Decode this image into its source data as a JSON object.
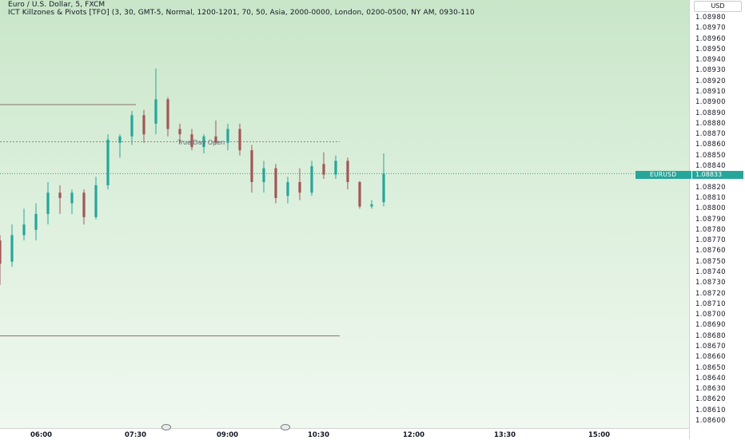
{
  "legend": {
    "line1": "Euro / U.S. Dollar, 5, FXCM",
    "line2": "ICT Killzones & Pivots [TFO] (3, 30, GMT-5, Normal, 1200-1201, 70, 50, Asia, 2000-0000, London, 0200-0500, NY AM, 0930-110"
  },
  "currency": "USD",
  "price_axis": {
    "labels": [
      "1.08980",
      "1.08970",
      "1.08960",
      "1.08950",
      "1.08940",
      "1.08930",
      "1.08920",
      "1.08910",
      "1.08900",
      "1.08890",
      "1.08880",
      "1.08870",
      "1.08860",
      "1.08850",
      "1.08840",
      "1.08820",
      "1.08810",
      "1.08800",
      "1.08790",
      "1.08780",
      "1.08770",
      "1.08760",
      "1.08750",
      "1.08740",
      "1.08730",
      "1.08720",
      "1.08710",
      "1.08700",
      "1.08690",
      "1.08680",
      "1.08670",
      "1.08660",
      "1.08650",
      "1.08640",
      "1.08630",
      "1.08620",
      "1.08610",
      "1.08600"
    ]
  },
  "time_axis": {
    "labels": [
      "06:00",
      "07:30",
      "09:00",
      "10:30",
      "12:00",
      "13:30",
      "15:00"
    ]
  },
  "last_price": {
    "symbol": "EURUSD",
    "value": "1.08833"
  },
  "annotation": {
    "true_day_open": "True Day Open"
  },
  "colors": {
    "up": "#26a69a",
    "down": "#a15757",
    "background_top": "#c9e6c9",
    "background_bottom": "#f0f8f0"
  },
  "chart_data": {
    "type": "candlestick",
    "symbol": "EURUSD",
    "timeframe": "5",
    "ylim": [
      1.08595,
      1.08985
    ],
    "levels": [
      {
        "price": 1.08898,
        "x_start": "05:35",
        "x_end": "06:35"
      },
      {
        "price": 1.08863,
        "x_start": "05:35",
        "x_end": "08:00",
        "label": "True Day Open",
        "dashed": true
      },
      {
        "price": 1.08833,
        "x_start": "05:35",
        "x_end": "16:55",
        "dotted": true
      },
      {
        "price": 1.0868,
        "x_start": "05:35",
        "x_end": "08:00"
      }
    ],
    "candles": [
      {
        "t": "05:35",
        "o": 1.0876,
        "h": 1.0878,
        "l": 1.08745,
        "c": 1.0875
      },
      {
        "t": "05:40",
        "o": 1.0877,
        "h": 1.08775,
        "l": 1.08728,
        "c": 1.08748
      },
      {
        "t": "05:45",
        "o": 1.0875,
        "h": 1.08785,
        "l": 1.08745,
        "c": 1.08775
      },
      {
        "t": "05:50",
        "o": 1.08775,
        "h": 1.088,
        "l": 1.0877,
        "c": 1.08785
      },
      {
        "t": "05:55",
        "o": 1.0878,
        "h": 1.08805,
        "l": 1.0877,
        "c": 1.08795
      },
      {
        "t": "06:00",
        "o": 1.08795,
        "h": 1.08825,
        "l": 1.08785,
        "c": 1.08815
      },
      {
        "t": "06:05",
        "o": 1.08815,
        "h": 1.08822,
        "l": 1.08795,
        "c": 1.0881
      },
      {
        "t": "06:10",
        "o": 1.08805,
        "h": 1.08818,
        "l": 1.08795,
        "c": 1.08815
      },
      {
        "t": "06:15",
        "o": 1.08815,
        "h": 1.08818,
        "l": 1.08785,
        "c": 1.08792
      },
      {
        "t": "06:20",
        "o": 1.08792,
        "h": 1.0883,
        "l": 1.0879,
        "c": 1.08822
      },
      {
        "t": "06:25",
        "o": 1.08822,
        "h": 1.0887,
        "l": 1.08818,
        "c": 1.08865
      },
      {
        "t": "06:30",
        "o": 1.08862,
        "h": 1.0887,
        "l": 1.08848,
        "c": 1.08868
      },
      {
        "t": "06:35",
        "o": 1.08868,
        "h": 1.08892,
        "l": 1.0886,
        "c": 1.08888
      },
      {
        "t": "06:40",
        "o": 1.08888,
        "h": 1.08893,
        "l": 1.08862,
        "c": 1.0887
      },
      {
        "t": "06:45",
        "o": 1.0888,
        "h": 1.08932,
        "l": 1.0887,
        "c": 1.08903
      },
      {
        "t": "06:50",
        "o": 1.08903,
        "h": 1.08905,
        "l": 1.08868,
        "c": 1.08875
      },
      {
        "t": "06:55",
        "o": 1.08875,
        "h": 1.0888,
        "l": 1.08862,
        "c": 1.0887
      },
      {
        "t": "07:00",
        "o": 1.0887,
        "h": 1.08875,
        "l": 1.08855,
        "c": 1.08858
      },
      {
        "t": "07:05",
        "o": 1.08858,
        "h": 1.0887,
        "l": 1.08852,
        "c": 1.08868
      },
      {
        "t": "07:10",
        "o": 1.08868,
        "h": 1.08883,
        "l": 1.0886,
        "c": 1.08862
      },
      {
        "t": "07:15",
        "o": 1.08862,
        "h": 1.0888,
        "l": 1.08855,
        "c": 1.08875
      },
      {
        "t": "07:20",
        "o": 1.08875,
        "h": 1.0888,
        "l": 1.0885,
        "c": 1.08855
      },
      {
        "t": "07:25",
        "o": 1.08855,
        "h": 1.0886,
        "l": 1.08815,
        "c": 1.08825
      },
      {
        "t": "07:30",
        "o": 1.08825,
        "h": 1.08845,
        "l": 1.08815,
        "c": 1.08838
      },
      {
        "t": "07:35",
        "o": 1.08838,
        "h": 1.08842,
        "l": 1.08805,
        "c": 1.0881
      },
      {
        "t": "07:40",
        "o": 1.08812,
        "h": 1.0883,
        "l": 1.08805,
        "c": 1.08825
      },
      {
        "t": "07:45",
        "o": 1.08825,
        "h": 1.08838,
        "l": 1.08808,
        "c": 1.08815
      },
      {
        "t": "07:50",
        "o": 1.08815,
        "h": 1.08845,
        "l": 1.08812,
        "c": 1.0884
      },
      {
        "t": "07:55",
        "o": 1.08842,
        "h": 1.08853,
        "l": 1.08828,
        "c": 1.08832
      },
      {
        "t": "08:00",
        "o": 1.08832,
        "h": 1.0885,
        "l": 1.08828,
        "c": 1.08845
      },
      {
        "t": "08:05",
        "o": 1.08845,
        "h": 1.08848,
        "l": 1.08818,
        "c": 1.08825
      },
      {
        "t": "08:10",
        "o": 1.08825,
        "h": 1.08826,
        "l": 1.088,
        "c": 1.08802
      },
      {
        "t": "08:15",
        "o": 1.08802,
        "h": 1.08808,
        "l": 1.088,
        "c": 1.08804
      },
      {
        "t": "08:20",
        "o": 1.08806,
        "h": 1.08852,
        "l": 1.08802,
        "c": 1.08833
      }
    ]
  }
}
